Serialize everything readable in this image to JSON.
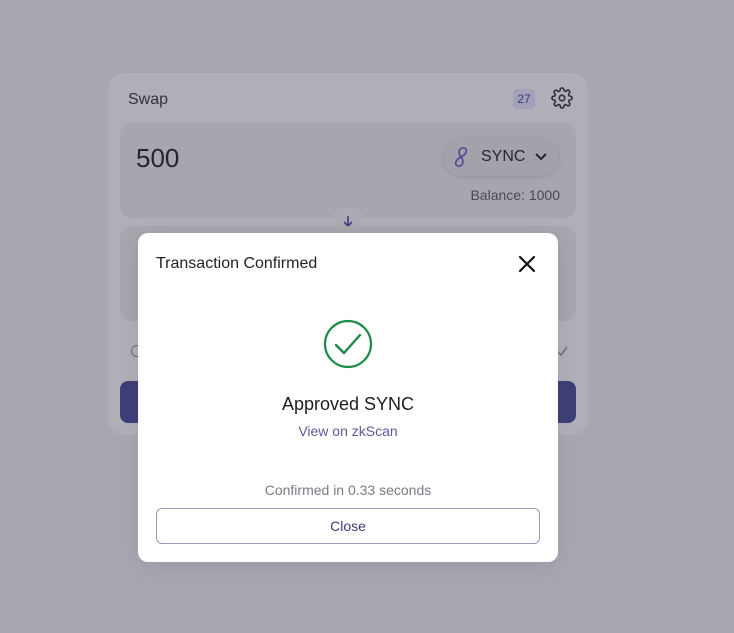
{
  "swap": {
    "title": "Swap",
    "badge": "27",
    "amount": "500",
    "token": "SYNC",
    "balance": "Balance: 1000"
  },
  "modal": {
    "title": "Transaction Confirmed",
    "status": "Approved SYNC",
    "link": "View on zkScan",
    "confirmed_time": "Confirmed in 0.33 seconds",
    "close_label": "Close"
  },
  "colors": {
    "accent": "#3f3f78",
    "success": "#1e8a4a",
    "link": "#5b5b98"
  }
}
